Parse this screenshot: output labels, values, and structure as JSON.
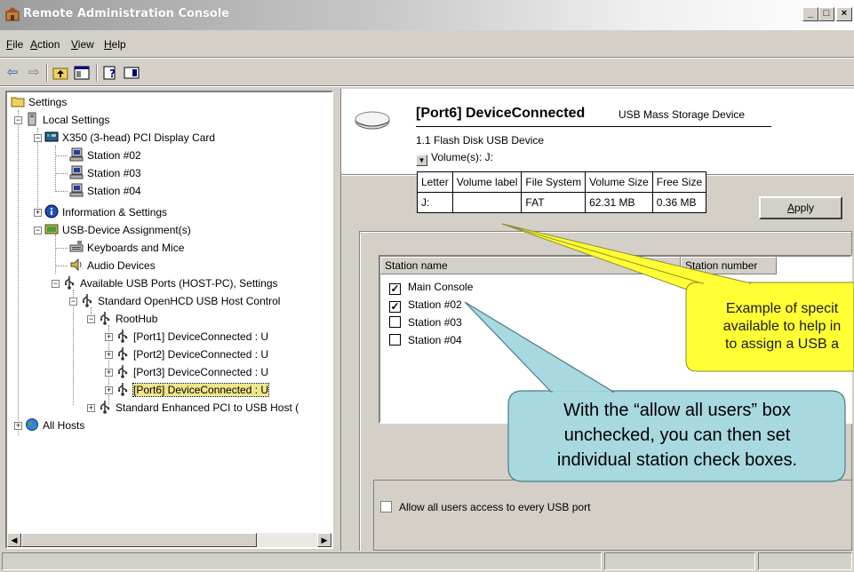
{
  "window": {
    "title": "Remote Administration Console",
    "controls": [
      "_",
      "□",
      "×"
    ]
  },
  "menu": {
    "items": [
      {
        "label": "File",
        "u": "F",
        "rest": "ile"
      },
      {
        "label": "Action",
        "u": "A",
        "rest": "ction"
      },
      {
        "label": "View",
        "u": "V",
        "rest": "iew"
      },
      {
        "label": "Help",
        "u": "H",
        "rest": "elp"
      }
    ]
  },
  "toolbar": {
    "icons": [
      "back-arrow-icon",
      "forward-arrow-icon",
      "up-folder-icon",
      "show-hide-tree-icon",
      "properties-help-icon",
      "action-pane-icon"
    ]
  },
  "tree": {
    "nodes": [
      {
        "label": "Settings",
        "icon": "folder-icon"
      },
      {
        "label": "Local Settings",
        "icon": "computer-icon"
      },
      {
        "label": "X350 (3-head)  PCI Display Card",
        "icon": "display-card-icon"
      },
      {
        "label": "Station #02",
        "icon": "station-icon"
      },
      {
        "label": "Station #03",
        "icon": "station-icon"
      },
      {
        "label": "Station #04",
        "icon": "station-icon"
      },
      {
        "label": "Information & Settings",
        "icon": "info-icon"
      },
      {
        "label": "USB-Device Assignment(s)",
        "icon": "usb-assign-icon"
      },
      {
        "label": "Keyboards and Mice",
        "icon": "keyboard-icon"
      },
      {
        "label": "Audio Devices",
        "icon": "audio-icon"
      },
      {
        "label": "Available USB Ports (HOST-PC), Settings",
        "icon": "usb-icon"
      },
      {
        "label": "Standard OpenHCD USB Host Control",
        "icon": "usb-icon"
      },
      {
        "label": "RootHub",
        "icon": "usb-icon"
      },
      {
        "label": "[Port1] DeviceConnected :  U",
        "icon": "usb-icon"
      },
      {
        "label": "[Port2] DeviceConnected :  U",
        "icon": "usb-icon"
      },
      {
        "label": "[Port3] DeviceConnected :  U",
        "icon": "usb-icon"
      },
      {
        "label": "[Port6] DeviceConnected :  U",
        "icon": "usb-icon"
      },
      {
        "label": "Standard Enhanced PCI to USB Host (",
        "icon": "usb-icon"
      },
      {
        "label": "All Hosts",
        "icon": "globe-icon"
      }
    ]
  },
  "device": {
    "title": "[Port6] DeviceConnected",
    "type": "USB Mass Storage Device",
    "name": "1.1 Flash Disk USB Device",
    "volumes_label": "Volume(s):  J:"
  },
  "volume_table": {
    "headers": [
      "Letter",
      "Volume label",
      "File System",
      "Volume Size",
      "Free Size"
    ],
    "rows": [
      [
        "J:",
        "",
        "FAT",
        "62.31 MB",
        "0.36 MB"
      ]
    ]
  },
  "apply_label": "Apply",
  "stations": {
    "headers": [
      "Station name",
      "Station number"
    ],
    "rows": [
      {
        "name": "Main Console",
        "checked": true
      },
      {
        "name": "Station #02",
        "checked": true
      },
      {
        "name": "Station #03",
        "checked": false
      },
      {
        "name": "Station #04",
        "checked": false
      }
    ]
  },
  "allow_all_label": "Allow all users access to every USB port",
  "allow_all_checked": false,
  "callouts": {
    "yellow": [
      "Example of specit",
      "available to help in",
      "to assign a USB a"
    ],
    "blue": [
      "With the “allow all users” box",
      "unchecked, you can then set",
      "individual station check boxes."
    ]
  },
  "colors": {
    "yellow_callout": "#ffff33",
    "blue_callout": "#a8d8e0",
    "window_face": "#d4d0c8"
  }
}
